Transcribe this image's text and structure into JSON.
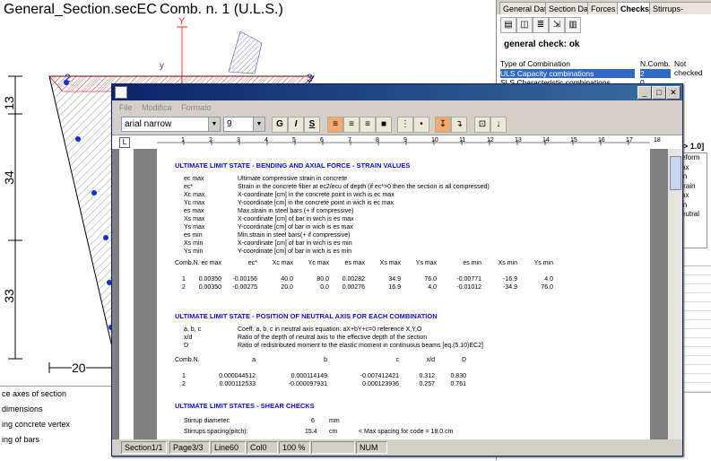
{
  "drawing": {
    "file_title": "General_Section.secEC",
    "comb_title": "Comb. n. 1 (U.L.S.)",
    "axis_y_upper": "Y",
    "axis_y_lower": "y",
    "dim_13": "13",
    "dim_34": "34",
    "dim_33": "33",
    "dim_20": "20",
    "vertex_2": "2",
    "vertex_3": "3"
  },
  "legend": {
    "items": [
      "ce axes of section",
      "dimensions",
      "ing concrete vertex",
      "ing of bars"
    ]
  },
  "right_panel": {
    "tabs": [
      "General Data",
      "Section Data",
      "Forces",
      "Checks",
      "Stirrups-Ductility"
    ],
    "check_result": "general check: ok",
    "table_headers": [
      "Type of Combination",
      "N.Comb.",
      "Not checked"
    ],
    "rows": [
      {
        "type": "ULS Capacity combinations",
        "n": "2"
      },
      {
        "type": "SLS Characteristic combinations",
        "n": "0"
      }
    ],
    "side_fragments": [
      "> 1.0]",
      "eform",
      "ax",
      "in",
      "train",
      "ax",
      "in",
      "eutral"
    ]
  },
  "editor": {
    "menu": [
      "File",
      "Modifica",
      "Formato"
    ],
    "font_name": "arial narrow",
    "font_size": "9",
    "bold": "G",
    "italic": "I",
    "strike": "S",
    "status": [
      "Section1/1",
      "Page3/3",
      "Line60",
      "Col0",
      "100 %",
      "NUM"
    ],
    "ruler_ticks": [
      "1",
      "2",
      "3",
      "4",
      "5",
      "6",
      "7",
      "8",
      "9",
      "10",
      "11",
      "12",
      "13",
      "14",
      "15",
      "16",
      "17",
      "18",
      "19"
    ]
  },
  "document": {
    "sec1_title": "ULTIMATE LIMIT STATE - BENDING AND AXIAL FORCE - STRAIN VALUES",
    "sec1_defs": [
      [
        "ec max",
        "Ultimate compressive strain in concrete"
      ],
      [
        "ec*",
        "Strain in the concrete fiber at ec2/ecu of depth (if ec*>0 then the section is all compressed)"
      ],
      [
        "Xc max",
        "X-coordinate [cm] in the concrete point in wich is ec max"
      ],
      [
        "Yc max",
        "Y-coordinate [cm] in the concrete point in wich is ec max"
      ],
      [
        "es max",
        "Max.strain in steel bars (+ if compressive)"
      ],
      [
        "Xs max",
        "X-coordinate [cm] of bar in wich is es max"
      ],
      [
        "Ys max",
        "Y-coordinate [cm] of bar in wich is es max"
      ],
      [
        "es min",
        "Min.strain in steel bars(+ if compressive)"
      ],
      [
        "Xs min",
        "X-coordinate [cm] of bar in wich is es min"
      ],
      [
        "Ys min",
        "Y-coordinate [cm] of bar in wich is es min"
      ]
    ],
    "sec1_headers": [
      "Comb.N.",
      "ec max",
      "ec*",
      "Xc max",
      "Yc max",
      "es max",
      "Xs max",
      "Ys max",
      "es min",
      "Xs min",
      "Ys min"
    ],
    "sec1_rows": [
      [
        "1",
        "0.00350",
        "-0.00156",
        "40.0",
        "80.0",
        "0.00282",
        "34.9",
        "76.0",
        "-0.00771",
        "-16.9",
        "4.0"
      ],
      [
        "2",
        "0.00350",
        "-0.00275",
        "20.0",
        "0.0",
        "0.00276",
        "16.9",
        "4.0",
        "-0.01012",
        "-34.9",
        "76.0"
      ]
    ],
    "sec2_title": "ULTIMATE LIMIT STATE - POSITION OF NEUTRAL AXIS FOR EACH COMBINATION",
    "sec2_defs": [
      [
        "a, b, c",
        "Coeff. a, b, c in neutral axis equation: aX+bY+c=0 reference X,Y,O"
      ],
      [
        "x/d",
        "Ratio of the depth of neutral axis to the effective depth of the section"
      ],
      [
        "D",
        "Ratio of redistributed moment to the elastic moment in continuous beams [eq.(5.10)EC2]"
      ]
    ],
    "sec2_headers": [
      "Comb.N.",
      "a",
      "b",
      "c",
      "x/d",
      "D"
    ],
    "sec2_rows": [
      [
        "1",
        "0.000044512",
        "0.000114149",
        "-0.007412421",
        "0.312",
        "0.830"
      ],
      [
        "2",
        "0.000112533",
        "-0.000097931",
        "0.000123936",
        "0.257",
        "0.761"
      ]
    ],
    "sec3_title": "ULTIMATE LIMIT STATES - SHEAR CHECKS",
    "stirrup_label": "Stirrup diameter:",
    "stirrup_value": "6",
    "stirrup_unit": "mm",
    "spacing_label": "Stirrups spacing(pitch):",
    "spacing_value": "15.4",
    "spacing_unit": "cm",
    "spacing_note": "<  Max spacing for code = 18.0 cm"
  }
}
